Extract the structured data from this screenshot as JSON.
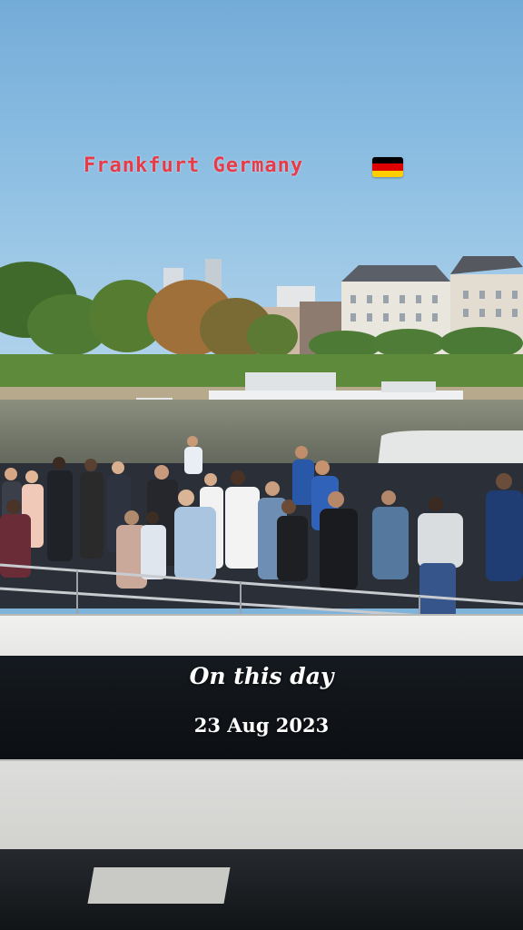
{
  "story": {
    "location_title": "Frankfurt Germany",
    "flag_icon": "germany-flag-icon",
    "memory_label": "On this day",
    "memory_date": "23 Aug 2023"
  },
  "colors": {
    "title": "#e83b48",
    "flag": [
      "#000000",
      "#dd0000",
      "#ffce00"
    ],
    "overlay_text": "#ffffff"
  }
}
